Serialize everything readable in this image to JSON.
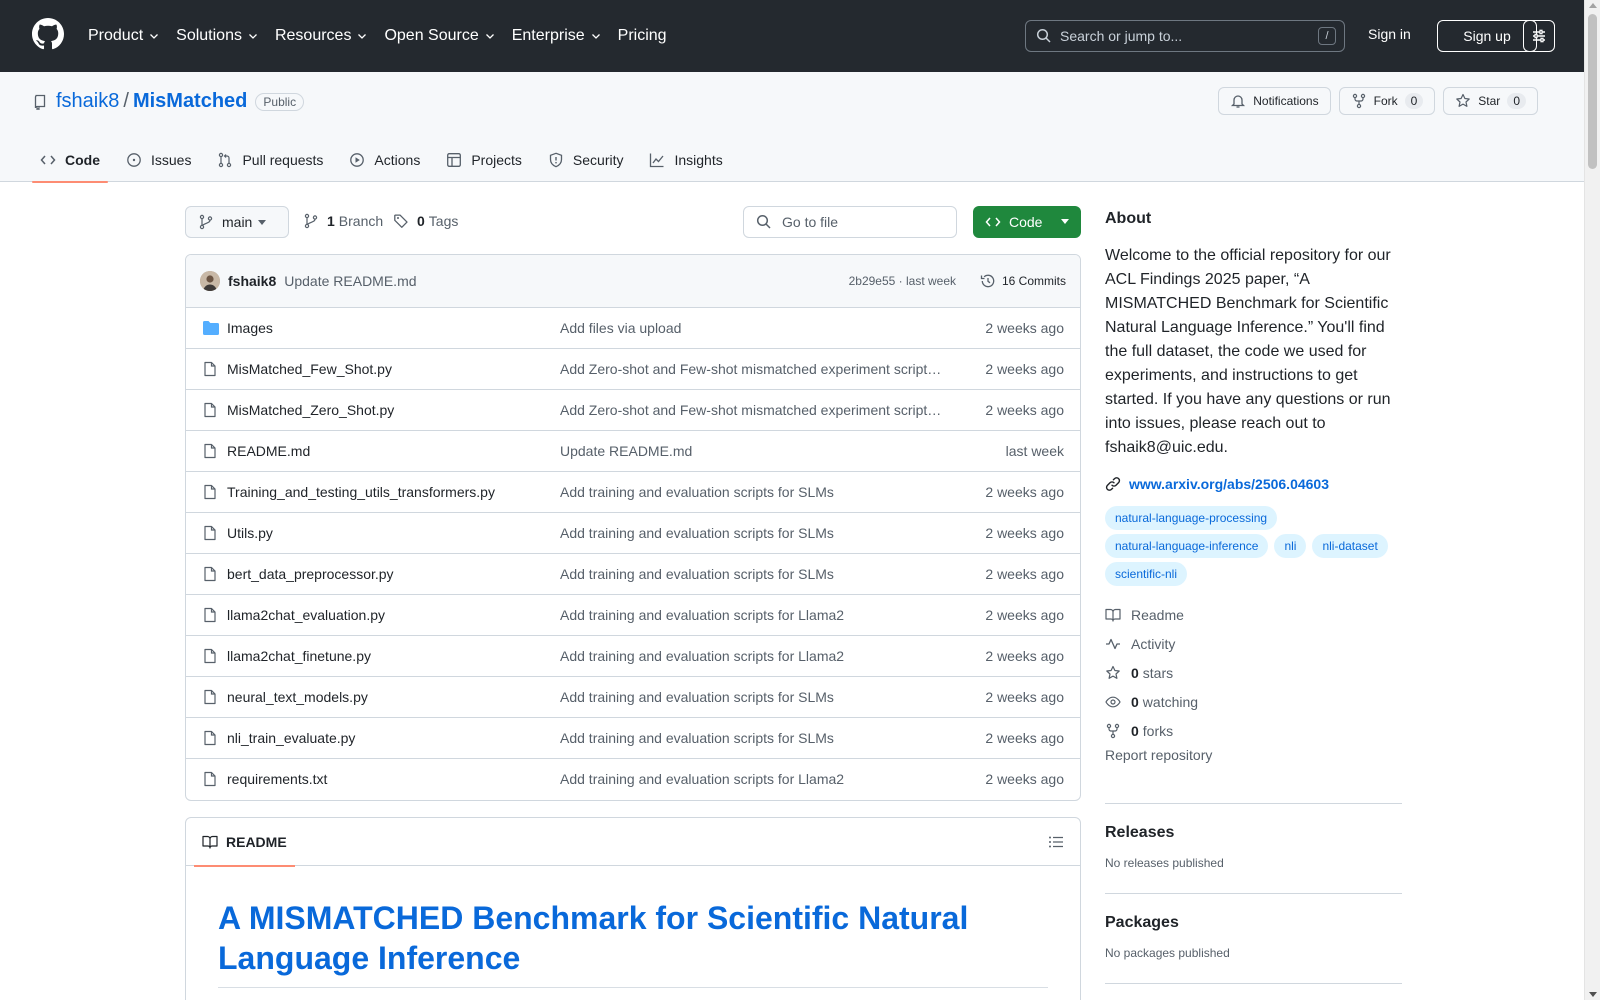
{
  "header": {
    "nav": [
      {
        "label": "Product"
      },
      {
        "label": "Solutions"
      },
      {
        "label": "Resources"
      },
      {
        "label": "Open Source"
      },
      {
        "label": "Enterprise"
      },
      {
        "label": "Pricing"
      }
    ],
    "search_placeholder": "Search or jump to...",
    "search_shortcut": "/",
    "signin": "Sign in",
    "signup": "Sign up"
  },
  "repo": {
    "owner": "fshaik8",
    "separator": "/",
    "name": "MisMatched",
    "visibility": "Public",
    "notifications_label": "Notifications",
    "fork_label": "Fork",
    "fork_count": "0",
    "star_label": "Star",
    "star_count": "0",
    "tabs": [
      {
        "label": "Code",
        "icon": "code-icon",
        "active": true
      },
      {
        "label": "Issues",
        "icon": "issue-icon"
      },
      {
        "label": "Pull requests",
        "icon": "pull-request-icon"
      },
      {
        "label": "Actions",
        "icon": "play-icon"
      },
      {
        "label": "Projects",
        "icon": "table-icon"
      },
      {
        "label": "Security",
        "icon": "shield-icon"
      },
      {
        "label": "Insights",
        "icon": "graph-icon"
      }
    ]
  },
  "toolbar": {
    "branch": "main",
    "branch_count": "1",
    "branch_label": "Branch",
    "tag_count": "0",
    "tag_label": "Tags",
    "goto_placeholder": "Go to file",
    "code_button": "Code"
  },
  "latest_commit": {
    "author": "fshaik8",
    "message": "Update README.md",
    "meta": "2b29e55 · last week",
    "commits": "16 Commits"
  },
  "files": [
    {
      "name": "Images",
      "type": "dir",
      "message": "Add files via upload",
      "age": "2 weeks ago"
    },
    {
      "name": "MisMatched_Few_Shot.py",
      "type": "file",
      "message": "Add Zero-shot and Few-shot mismatched experiment script…",
      "age": "2 weeks ago"
    },
    {
      "name": "MisMatched_Zero_Shot.py",
      "type": "file",
      "message": "Add Zero-shot and Few-shot mismatched experiment script…",
      "age": "2 weeks ago"
    },
    {
      "name": "README.md",
      "type": "file",
      "message": "Update README.md",
      "age": "last week"
    },
    {
      "name": "Training_and_testing_utils_transformers.py",
      "type": "file",
      "message": "Add training and evaluation scripts for SLMs",
      "age": "2 weeks ago"
    },
    {
      "name": "Utils.py",
      "type": "file",
      "message": "Add training and evaluation scripts for SLMs",
      "age": "2 weeks ago"
    },
    {
      "name": "bert_data_preprocessor.py",
      "type": "file",
      "message": "Add training and evaluation scripts for SLMs",
      "age": "2 weeks ago"
    },
    {
      "name": "llama2chat_evaluation.py",
      "type": "file",
      "message": "Add training and evaluation scripts for Llama2",
      "age": "2 weeks ago"
    },
    {
      "name": "llama2chat_finetune.py",
      "type": "file",
      "message": "Add training and evaluation scripts for Llama2",
      "age": "2 weeks ago"
    },
    {
      "name": "neural_text_models.py",
      "type": "file",
      "message": "Add training and evaluation scripts for SLMs",
      "age": "2 weeks ago"
    },
    {
      "name": "nli_train_evaluate.py",
      "type": "file",
      "message": "Add training and evaluation scripts for SLMs",
      "age": "2 weeks ago"
    },
    {
      "name": "requirements.txt",
      "type": "file",
      "message": "Add training and evaluation scripts for Llama2",
      "age": "2 weeks ago"
    }
  ],
  "readme": {
    "tab_label": "README",
    "title": "A MISMATCHED Benchmark for Scientific Natural Language Inference"
  },
  "about": {
    "heading": "About",
    "description": "Welcome to the official repository for our ACL Findings 2025 paper, “A MISMATCHED Benchmark for Scientific Natural Language Inference.” You'll find the full dataset, the code we used for experiments, and instructions to get started. If you have any questions or run into issues, please reach out to fshaik8@uic.edu.",
    "link": "www.arxiv.org/abs/2506.04603",
    "topics": [
      "natural-language-processing",
      "natural-language-inference",
      "nli",
      "nli-dataset",
      "scientific-nli"
    ],
    "readme": "Readme",
    "activity": "Activity",
    "stars_count": "0",
    "stars_label": "stars",
    "watching_count": "0",
    "watching_label": "watching",
    "forks_count": "0",
    "forks_label": "forks",
    "report": "Report repository"
  },
  "releases": {
    "heading": "Releases",
    "empty": "No releases published"
  },
  "packages": {
    "heading": "Packages",
    "empty": "No packages published"
  },
  "colors": {
    "accent": "#0969da",
    "header_bg": "#24292f",
    "code_button": "#1f883d",
    "tab_underline": "#fd8c73"
  }
}
